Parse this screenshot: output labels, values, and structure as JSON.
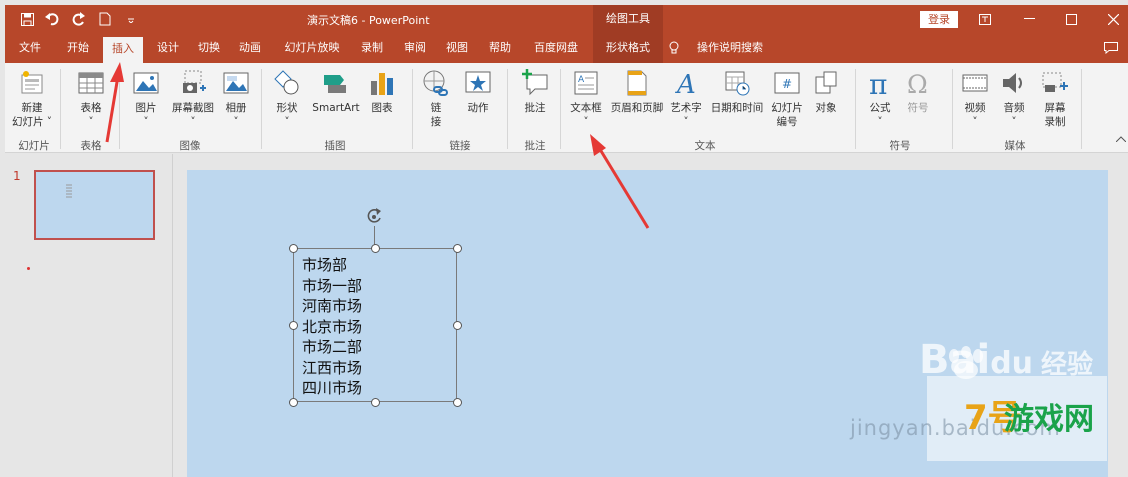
{
  "titlebar": {
    "title": "演示文稿6 - PowerPoint",
    "tools_label": "绘图工具",
    "login": "登录"
  },
  "tabs": [
    {
      "label": "文件"
    },
    {
      "label": "开始"
    },
    {
      "label": "插入"
    },
    {
      "label": "设计"
    },
    {
      "label": "切换"
    },
    {
      "label": "动画"
    },
    {
      "label": "幻灯片放映"
    },
    {
      "label": "录制"
    },
    {
      "label": "审阅"
    },
    {
      "label": "视图"
    },
    {
      "label": "帮助"
    },
    {
      "label": "百度网盘"
    },
    {
      "label": "形状格式"
    }
  ],
  "tell_me": "操作说明搜索",
  "ribbon": {
    "new_slide": "新建",
    "new_slide2": "幻灯片 ˅",
    "table": "表格",
    "picture": "图片",
    "screenshot": "屏幕截图",
    "album": "相册",
    "shapes": "形状",
    "smartart": "SmartArt",
    "chart": "图表",
    "link": "链",
    "link2": "接",
    "action": "动作",
    "comment": "批注",
    "textbox": "文本框",
    "header_footer": "页眉和页脚",
    "wordart": "艺术字",
    "datetime": "日期和时间",
    "slide_number": "幻灯片",
    "slide_number2": "编号",
    "object": "对象",
    "equation": "公式",
    "symbol": "符号",
    "video": "视频",
    "audio": "音频",
    "screen_rec": "屏幕",
    "screen_rec2": "录制",
    "dropdown": "˅"
  },
  "groups": {
    "slides": "幻灯片",
    "tables": "表格",
    "images": "图像",
    "illustrations": "插图",
    "links": "链接",
    "comments": "批注",
    "text": "文本",
    "symbols": "符号",
    "media": "媒体"
  },
  "slide_panel": {
    "number": "1"
  },
  "textbox_lines": [
    "市场部",
    "市场一部",
    "河南市场",
    "北京市场",
    "市场二部",
    "江西市场",
    "四川市场"
  ],
  "watermark": {
    "brand": "Bai",
    "brand_du": "du",
    "cn": "经验",
    "url": "jingyan.baidu.com",
    "logo_7": "7号",
    "logo_cn": "游戏网"
  },
  "colors": {
    "accent": "#b7472a",
    "slide_bg": "#bdd7ee",
    "arrow": "#e53935"
  }
}
